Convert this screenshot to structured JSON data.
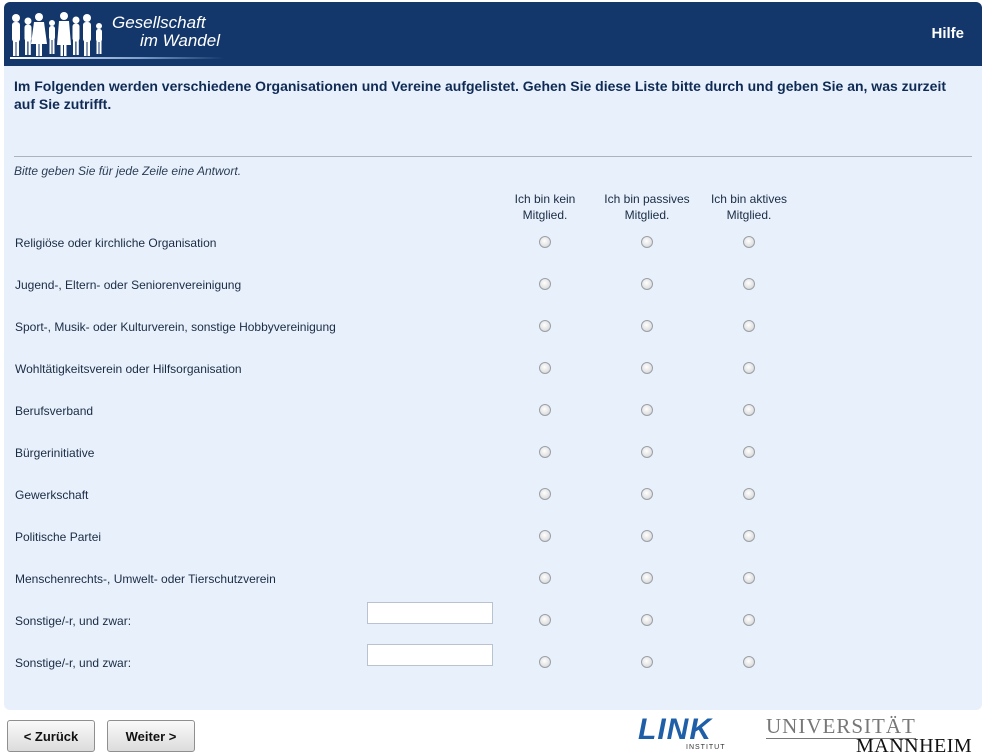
{
  "header": {
    "logo_line1": "Gesellschaft",
    "logo_line2": "im Wandel",
    "help_label": "Hilfe"
  },
  "question": "Im Folgenden werden verschiedene Organisationen und Vereine aufgelistet. Gehen Sie diese Liste bitte durch und geben Sie an, was zurzeit auf Sie zutrifft.",
  "instruction": "Bitte geben Sie für jede Zeile eine Antwort.",
  "columns": [
    {
      "line1": "Ich bin kein",
      "line2": "Mitglied."
    },
    {
      "line1": "Ich bin passives",
      "line2": "Mitglied."
    },
    {
      "line1": "Ich bin aktives",
      "line2": "Mitglied."
    }
  ],
  "rows": [
    {
      "label": "Religiöse oder kirchliche Organisation"
    },
    {
      "label": "Jugend-, Eltern- oder Seniorenvereinigung"
    },
    {
      "label": "Sport-, Musik- oder Kulturverein, sonstige Hobbyvereinigung"
    },
    {
      "label": "Wohltätigkeitsverein oder Hilfsorganisation"
    },
    {
      "label": "Berufsverband"
    },
    {
      "label": "Bürgerinitiative"
    },
    {
      "label": "Gewerkschaft"
    },
    {
      "label": "Politische Partei"
    },
    {
      "label": "Menschenrechts-, Umwelt- oder Tierschutzverein"
    },
    {
      "label": "Sonstige/-r, und zwar:",
      "input_value": ""
    },
    {
      "label": "Sonstige/-r, und zwar:",
      "input_value": ""
    }
  ],
  "nav": {
    "back_label": "< Zurück",
    "next_label": "Weiter >"
  },
  "footer": {
    "link_logo": "LINK",
    "link_sub": "INSTITUT",
    "uni_line1": "UNIVERSITÄT",
    "uni_line2": "MANNHEIM"
  },
  "colors": {
    "header_bg": "#14376b",
    "panel_bg": "#e8f1fb",
    "question_text": "#0f2a55"
  }
}
